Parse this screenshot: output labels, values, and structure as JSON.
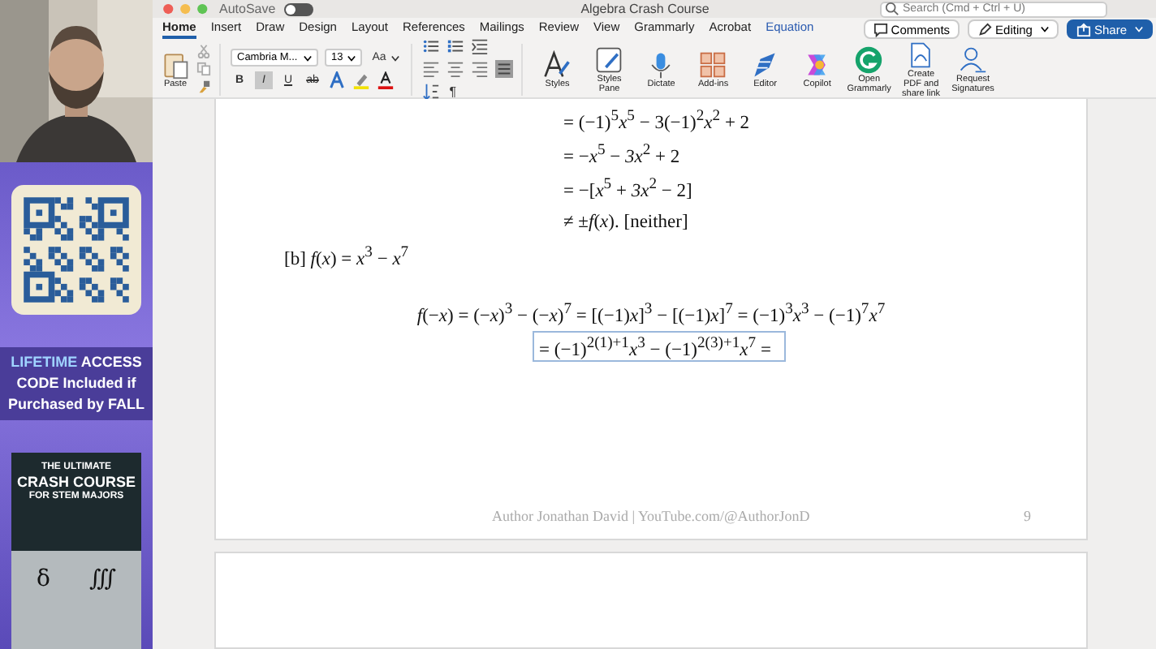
{
  "promo": {
    "highlight": "LIFETIME",
    "text": "ACCESS CODE Included if Purchased by FALL"
  },
  "book": {
    "lines": [
      "THE ULTIMATE",
      "CRASH COURSE",
      "FOR STEM MAJORS"
    ],
    "symbols": [
      "δ",
      "∭"
    ]
  },
  "window": {
    "autosave": "AutoSave",
    "autosave_on": false,
    "title": "Algebra Crash Course",
    "search": {
      "placeholder": "Search (Cmd + Ctrl + U)"
    }
  },
  "tabs": [
    {
      "label": "Home",
      "selected": true,
      "kind": "standard"
    },
    {
      "label": "Insert",
      "selected": false,
      "kind": "standard"
    },
    {
      "label": "Draw",
      "selected": false,
      "kind": "standard"
    },
    {
      "label": "Design",
      "selected": false,
      "kind": "standard"
    },
    {
      "label": "Layout",
      "selected": false,
      "kind": "standard"
    },
    {
      "label": "References",
      "selected": false,
      "kind": "standard"
    },
    {
      "label": "Mailings",
      "selected": false,
      "kind": "standard"
    },
    {
      "label": "Review",
      "selected": false,
      "kind": "standard"
    },
    {
      "label": "View",
      "selected": false,
      "kind": "standard"
    },
    {
      "label": "Grammarly",
      "selected": false,
      "kind": "standard"
    },
    {
      "label": "Acrobat",
      "selected": false,
      "kind": "standard"
    },
    {
      "label": "Equation",
      "selected": false,
      "kind": "contextual"
    }
  ],
  "top_buttons": {
    "comments": "Comments",
    "editing": "Editing",
    "share": "Share"
  },
  "ribbon": {
    "paste": "Paste",
    "font": "Cambria M...",
    "size": "13",
    "change_case": "Aa",
    "format_buttons": [
      {
        "label": "B",
        "pressed": false
      },
      {
        "label": "I",
        "pressed": true
      },
      {
        "label": "U",
        "pressed": false
      },
      {
        "label": "ab",
        "pressed": false
      }
    ],
    "pilcrow": "¶",
    "tools": [
      {
        "label": "Styles",
        "kind": "styles"
      },
      {
        "label": "Styles Pane",
        "kind": "pane"
      },
      {
        "label": "Dictate",
        "kind": "mic"
      },
      {
        "label": "Add-ins",
        "kind": "grid"
      },
      {
        "label": "Editor",
        "kind": "pen"
      },
      {
        "label": "Copilot",
        "kind": "copilot"
      },
      {
        "label": "Open Grammarly",
        "kind": "grammarly"
      },
      {
        "label": "Create PDF and share link",
        "kind": "pdf"
      },
      {
        "label": "Request Signatures",
        "kind": "sign"
      }
    ]
  },
  "document": {
    "lines": [
      {
        "kind": "step",
        "text": "= (−1)$^{5}$*x*$^{5}$ − 3(−1)$^{2}$*x*$^{2}$ + 2"
      },
      {
        "kind": "step",
        "text": "= −*x*$^{5}$ − *3x*$^{2}$ + 2"
      },
      {
        "kind": "step",
        "text": "= −[*x*$^{5}$ + *3x*$^{2}$ − 2]"
      },
      {
        "kind": "step",
        "text": "≠ ±*f*(*x*). [neither]"
      },
      {
        "kind": "item",
        "text": "[b] *f*(*x*) = *x*$^{3}$ − *x*$^{7}$"
      },
      {
        "kind": "centered",
        "text": "*f*(−*x*) = (−*x*)$^{3}$ − (−*x*)$^{7}$ = [(−1)*x*]$^{3}$ − [(−1)*x*]$^{7}$ = (−1)$^{3}$*x*$^{3}$ − (−1)$^{7}$*x*$^{7}$"
      },
      {
        "kind": "editing",
        "text": "= (−1)$^{2(1)+1}$*x*$^{3}$ − (−1)$^{2(3)+1}$*x*$^{7}$ ="
      }
    ],
    "footer": "Author Jonathan David | YouTube.com/@AuthorJonD",
    "page_number": "9"
  }
}
